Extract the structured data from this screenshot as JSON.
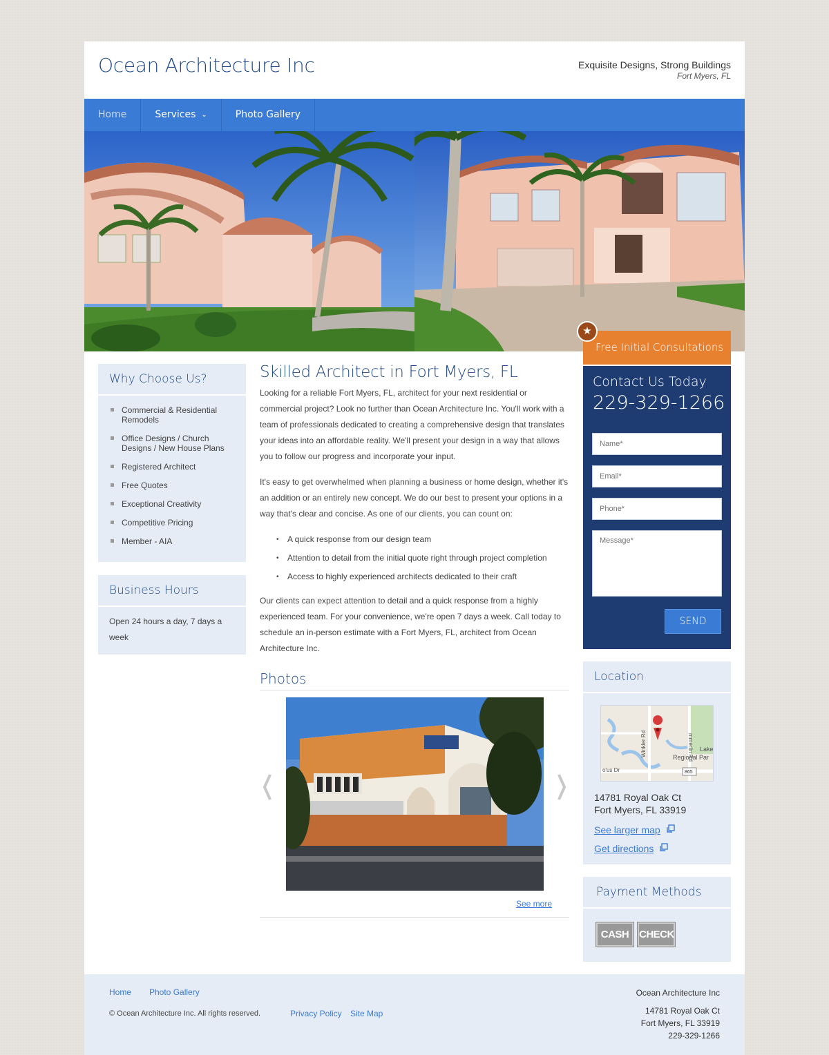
{
  "header": {
    "site_title": "Ocean Architecture Inc",
    "tagline": "Exquisite Designs, Strong Buildings",
    "location": "Fort Myers, FL"
  },
  "nav": {
    "items": [
      {
        "label": "Home",
        "active": true
      },
      {
        "label": "Services",
        "has_dropdown": true
      },
      {
        "label": "Photo Gallery"
      }
    ]
  },
  "why": {
    "title": "Why Choose Us?",
    "items": [
      "Commercial & Residential Remodels",
      "Office Designs / Church Designs / New House Plans",
      "Registered Architect",
      "Free Quotes",
      "Exceptional Creativity",
      "Competitive Pricing",
      "Member - AIA"
    ]
  },
  "hours": {
    "title": "Business Hours",
    "text": "Open 24 hours a day, 7 days a week"
  },
  "main": {
    "heading": "Skilled Architect in Fort Myers, FL",
    "p1": "Looking for a reliable Fort Myers, FL, architect for your next residential or commercial project? Look no further than Ocean Architecture Inc. You'll work with a team of professionals dedicated to creating a comprehensive design that translates your ideas into an affordable reality. We'll present your design in a way that allows you to follow our progress and incorporate your input.",
    "p2": "It's easy to get overwhelmed when planning a business or home design, whether it's an addition or an entirely new concept. We do our best to present your options in a way that's clear and concise. As one of our clients, you can count on:",
    "bullets": [
      "A quick response from our design team",
      "Attention to detail from the initial quote right through project completion",
      "Access to highly experienced architects dedicated to their craft"
    ],
    "p3": "Our clients can expect attention to detail and a quick response from a highly experienced team. For your convenience, we're open 7 days a week. Call today to schedule an in-person estimate with a Fort Myers, FL, architect from Ocean Architecture Inc.",
    "photos_heading": "Photos",
    "see_more": "See more"
  },
  "contact": {
    "ribbon": "Free Initial Consultations",
    "title": "Contact Us Today",
    "phone": "229-329-1266",
    "name_placeholder": "Name*",
    "email_placeholder": "Email*",
    "phone_placeholder": "Phone*",
    "message_placeholder": "Message*",
    "send_label": "SEND"
  },
  "location": {
    "title": "Location",
    "address1": "14781 Royal Oak Ct",
    "address2": "Fort Myers, FL 33919",
    "larger_map": "See larger map",
    "directions": "Get directions",
    "map_labels": [
      "Winkler Rd",
      "mmerlin Rd",
      "Lake",
      "Regional Par",
      "o'us Dr",
      "865"
    ]
  },
  "payment": {
    "title": "Payment Methods",
    "methods": [
      "CASH",
      "CHECK"
    ]
  },
  "footer": {
    "links": [
      "Home",
      "Photo Gallery"
    ],
    "copyright": "© Ocean Architecture Inc. All rights reserved.",
    "privacy": "Privacy Policy",
    "sitemap": "Site Map",
    "company": "Ocean Architecture Inc",
    "address1": "14781 Royal Oak Ct",
    "address2": "Fort Myers, FL 33919",
    "phone": "229-329-1266"
  },
  "colors": {
    "brand_blue": "#3a7bd5",
    "navy": "#1f3c72",
    "accent_orange": "#e8812f",
    "panel": "#e6ecf6"
  }
}
